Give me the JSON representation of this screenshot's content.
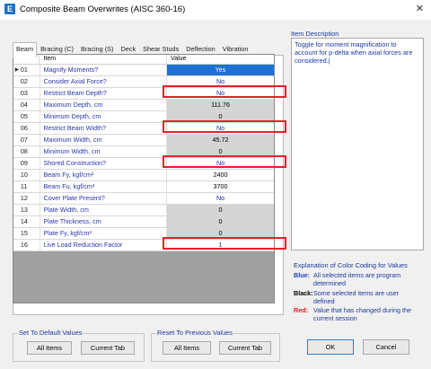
{
  "window": {
    "title": "Composite Beam Overwrites (AISC 360-16)",
    "icon_letter": "E",
    "close_glyph": "✕"
  },
  "tabs": [
    {
      "label": "Beam"
    },
    {
      "label": "Bracing (C)"
    },
    {
      "label": "Bracing (S)"
    },
    {
      "label": "Deck"
    },
    {
      "label": "Shear Studs"
    },
    {
      "label": "Deflection"
    },
    {
      "label": "Vibration"
    }
  ],
  "grid": {
    "header": {
      "item": "Item",
      "value": "Value"
    },
    "rows": [
      {
        "num": "01",
        "item": "Magnify Moments?",
        "value": "Yes",
        "value_color": "blue",
        "selected": true,
        "highlighted": false,
        "shaded": false
      },
      {
        "num": "02",
        "item": "Consider Axial Force?",
        "value": "No",
        "value_color": "blue",
        "selected": false,
        "highlighted": false,
        "shaded": false
      },
      {
        "num": "03",
        "item": "Restrict Beam Depth?",
        "value": "No",
        "value_color": "blue",
        "selected": false,
        "highlighted": true,
        "shaded": false
      },
      {
        "num": "04",
        "item": "Maximum Depth, cm",
        "value": "111.76",
        "value_color": "black",
        "selected": false,
        "highlighted": false,
        "shaded": true
      },
      {
        "num": "05",
        "item": "Minimum Depth, cm",
        "value": "0",
        "value_color": "black",
        "selected": false,
        "highlighted": false,
        "shaded": true
      },
      {
        "num": "06",
        "item": "Restrict Beam Width?",
        "value": "No",
        "value_color": "blue",
        "selected": false,
        "highlighted": true,
        "shaded": false
      },
      {
        "num": "07",
        "item": "Maximum Width, cm",
        "value": "45.72",
        "value_color": "black",
        "selected": false,
        "highlighted": false,
        "shaded": true
      },
      {
        "num": "08",
        "item": "Minimum Width, cm",
        "value": "0",
        "value_color": "black",
        "selected": false,
        "highlighted": false,
        "shaded": true
      },
      {
        "num": "09",
        "item": "Shored Construction?",
        "value": "No",
        "value_color": "blue",
        "selected": false,
        "highlighted": true,
        "shaded": false
      },
      {
        "num": "10",
        "item": "Beam Fy, kgf/cm²",
        "value": "2400",
        "value_color": "black",
        "selected": false,
        "highlighted": false,
        "shaded": false
      },
      {
        "num": "11",
        "item": "Beam Fu, kgf/cm²",
        "value": "3700",
        "value_color": "black",
        "selected": false,
        "highlighted": false,
        "shaded": false
      },
      {
        "num": "12",
        "item": "Cover Plate Present?",
        "value": "No",
        "value_color": "blue",
        "selected": false,
        "highlighted": false,
        "shaded": false
      },
      {
        "num": "13",
        "item": "Plate Width, cm",
        "value": "0",
        "value_color": "black",
        "selected": false,
        "highlighted": false,
        "shaded": true
      },
      {
        "num": "14",
        "item": "Plate Thickness, cm",
        "value": "0",
        "value_color": "black",
        "selected": false,
        "highlighted": false,
        "shaded": true
      },
      {
        "num": "15",
        "item": "Plate Fy, kgf/cm²",
        "value": "0",
        "value_color": "black",
        "selected": false,
        "highlighted": false,
        "shaded": true
      },
      {
        "num": "16",
        "item": "Live Load Reduction Factor",
        "value": "1",
        "value_color": "blue",
        "selected": false,
        "highlighted": true,
        "shaded": false
      }
    ]
  },
  "description": {
    "label": "Item Description",
    "text": "Toggle for moment magnification to account for p-delta when axial forces are considered.|"
  },
  "legend": {
    "title": "Explanation of Color Coding for Values",
    "entries": [
      {
        "key": "Blue:",
        "text": "All selected items are program determined",
        "color": "#1a3fbf"
      },
      {
        "key": "Black:",
        "text": "Some selected items are user defined",
        "color": "#000000"
      },
      {
        "key": "Red:",
        "text": "Value that has changed during the current session",
        "color": "#e0201a"
      }
    ]
  },
  "set_default": {
    "title": "Set To Default Values",
    "all_items": "All Items",
    "current_tab": "Current Tab"
  },
  "reset_previous": {
    "title": "Reset To Previous Values",
    "all_items": "All Items",
    "current_tab": "Current Tab"
  },
  "actions": {
    "ok": "OK",
    "cancel": "Cancel"
  },
  "colors": {
    "selection": "#1e70d2",
    "highlight": "#e8202a",
    "label_blue": "#1a3a9a"
  }
}
